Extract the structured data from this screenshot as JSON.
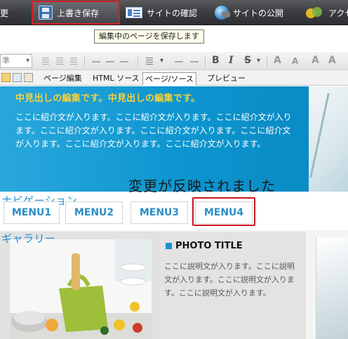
{
  "commands": {
    "edit_label": "更",
    "save_label": "上書き保存",
    "preview_label": "サイトの確認",
    "publish_label": "サイトの公開",
    "access_label": "アクセス"
  },
  "tooltip": "編集中のページを保存します",
  "format_toolbar": {
    "style_select_value": "準",
    "bold": "B",
    "italic": "I",
    "strike": "S",
    "font_grow": "A",
    "font_shrink": "A"
  },
  "mode_tabs": [
    {
      "label": "ページ編集"
    },
    {
      "label": "HTML ソース"
    },
    {
      "label": "ページ/ソース"
    },
    {
      "label": "プレビュー"
    }
  ],
  "page": {
    "hero_heading": "中見出しの編集です。中見出しの編集です。",
    "hero_body": "ここに紹介文が入ります。ここに紹介文が入ります。ここに紹介文が入ります。ここに紹介文が入ります。ここに紹介文が入ります。ここに紹介文が入ります。ここに紹介文が入ります。ここに紹介文が入ります。",
    "banner": "変更が反映されました",
    "nav_heading": "ナビゲーション",
    "menu": [
      "MENU1",
      "MENU2",
      "MENU3",
      "MENU4"
    ],
    "gallery_heading": "ギャラリー",
    "photo_title": "PHOTO TITLE",
    "photo_description": "ここに説明文が入ります。ここに説明文が入ります。ここに説明文が入ります。ここに説明文が入ります。"
  },
  "colors": {
    "highlight": "#d51f24",
    "hero_blue": "#0d95cf",
    "heading_yellow": "#f5d23a",
    "link_blue": "#2a90c8"
  }
}
